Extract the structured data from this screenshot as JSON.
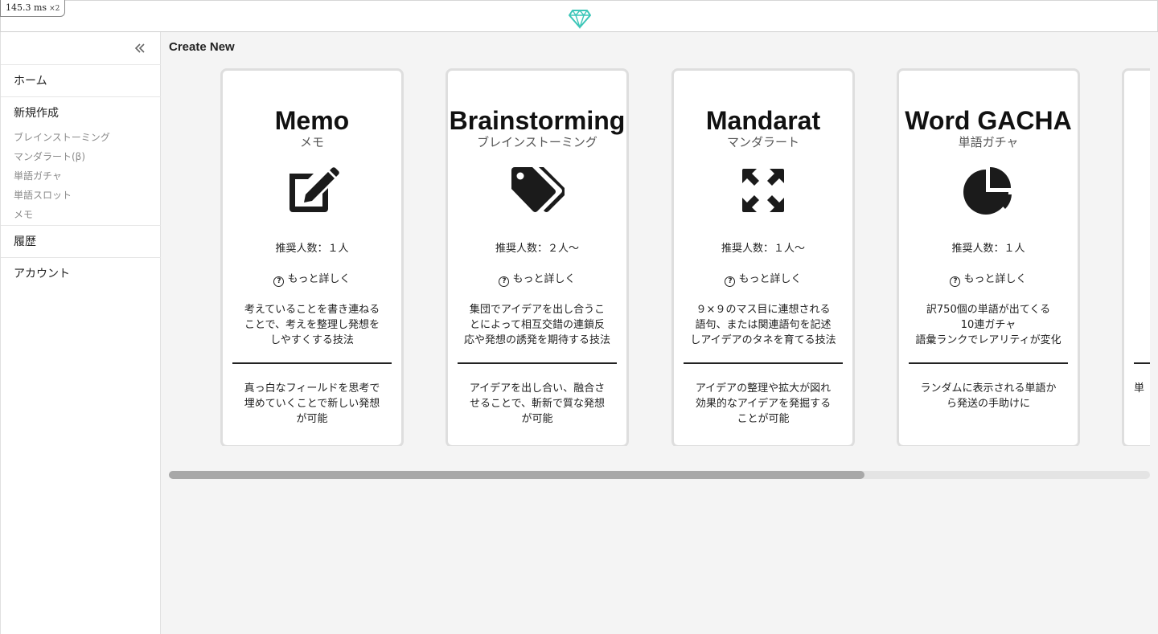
{
  "perf": {
    "time": "145.3 ms",
    "multiplier": "×2"
  },
  "header": {
    "logo_icon": "diamond-logo-icon",
    "accent": "#3cc6b8"
  },
  "sidebar": {
    "collapse_icon": "double-chevron-left-icon",
    "home": "ホーム",
    "create": {
      "label": "新規作成",
      "items": [
        "ブレインストーミング",
        "マンダラート(β)",
        "単語ガチャ",
        "単語スロット",
        "メモ"
      ]
    },
    "history": "履歴",
    "account": "アカウント"
  },
  "main": {
    "title": "Create New",
    "cards": [
      {
        "title": "Memo",
        "subtitle": "メモ",
        "icon": "edit-icon",
        "recommended": "推奨人数：１人",
        "more": "もっと詳しく",
        "desc": [
          "考えていることを書き連ねる",
          "ことで、考えを整理し発想を",
          "しやすくする技法"
        ],
        "benefit": [
          "真っ白なフィールドを思考で",
          "埋めていくことで新しい発想",
          "が可能"
        ]
      },
      {
        "title": "Brainstorming",
        "subtitle": "ブレインストーミング",
        "icon": "tags-icon",
        "recommended": "推奨人数：２人〜",
        "more": "もっと詳しく",
        "desc": [
          "集団でアイデアを出し合うこ",
          "とによって相互交錯の連鎖反",
          "応や発想の誘発を期待する技法"
        ],
        "benefit": [
          "アイデアを出し合い、融合さ",
          "せることで、斬新で質な発想",
          "が可能"
        ]
      },
      {
        "title": "Mandarat",
        "subtitle": "マンダラート",
        "icon": "expand-arrows-icon",
        "recommended": "推奨人数：１人〜",
        "more": "もっと詳しく",
        "desc": [
          "９×９のマス目に連想される",
          "語句、または関連語句を記述",
          "しアイデアのタネを育てる技法"
        ],
        "benefit": [
          "アイデアの整理や拡大が図れ",
          "効果的なアイデアを発掘する",
          "ことが可能"
        ]
      },
      {
        "title": "Word GACHA",
        "subtitle": "単語ガチャ",
        "icon": "pie-chart-icon",
        "recommended": "推奨人数：１人",
        "more": "もっと詳しく",
        "desc": [
          "訳750個の単語が出てくる",
          "10連ガチャ",
          "語彙ランクでレアリティが変化"
        ],
        "benefit": [
          "ランダムに表示される単語か",
          "ら発送の手助けに"
        ]
      },
      {
        "title": "",
        "subtitle": "",
        "icon": "",
        "recommended": "",
        "more": "",
        "desc": [],
        "benefit": [
          "単"
        ]
      }
    ]
  },
  "scroll": {
    "position": 0.709
  }
}
